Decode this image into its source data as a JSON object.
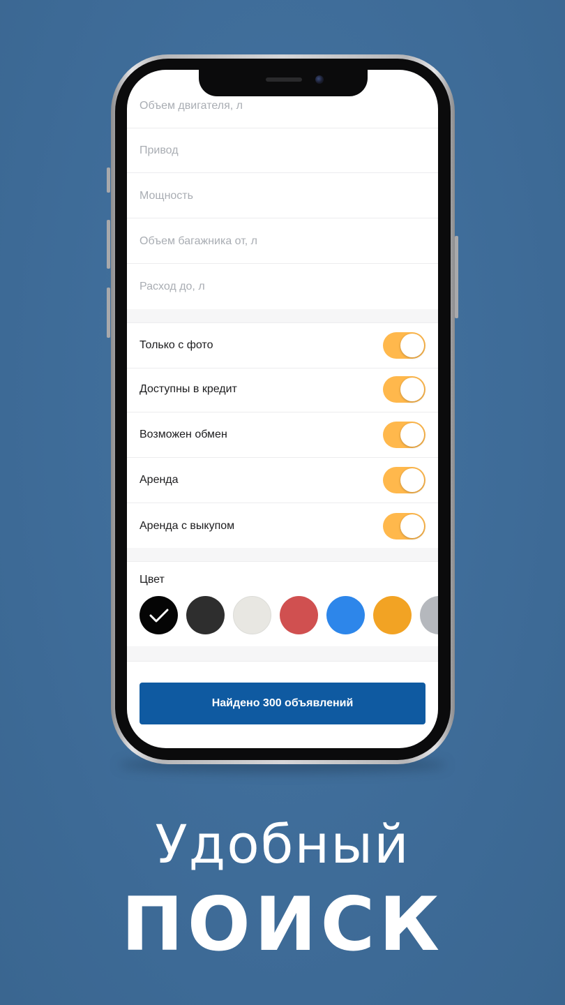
{
  "filters": {
    "fields": [
      {
        "label": "Объем двигателя, л"
      },
      {
        "label": "Привод"
      },
      {
        "label": "Мощность"
      },
      {
        "label": "Объем багажника от, л"
      },
      {
        "label": "Расход до, л"
      }
    ],
    "toggles": [
      {
        "label": "Только с фото",
        "on": true
      },
      {
        "label": "Доступны в кредит",
        "on": true
      },
      {
        "label": "Возможен обмен",
        "on": true
      },
      {
        "label": "Аренда",
        "on": true
      },
      {
        "label": "Аренда с выкупом",
        "on": true
      }
    ],
    "toggle_color": "#ffb84c",
    "color_section": {
      "title": "Цвет",
      "swatches": [
        {
          "name": "black",
          "hex": "#050505",
          "selected": true
        },
        {
          "name": "dark-gray",
          "hex": "#2e2e2e",
          "selected": false
        },
        {
          "name": "white",
          "hex": "#e8e7e2",
          "selected": false
        },
        {
          "name": "red",
          "hex": "#d05050",
          "selected": false
        },
        {
          "name": "blue",
          "hex": "#2d86ea",
          "selected": false
        },
        {
          "name": "orange",
          "hex": "#f2a324",
          "selected": false
        },
        {
          "name": "silver",
          "hex": "#b5b8bd",
          "selected": false
        }
      ]
    },
    "submit_button": "Найдено 300 объявлений",
    "accent_color": "#0f5aa1"
  },
  "promo": {
    "line1": "Удобный",
    "line2": "ПОИСК"
  }
}
